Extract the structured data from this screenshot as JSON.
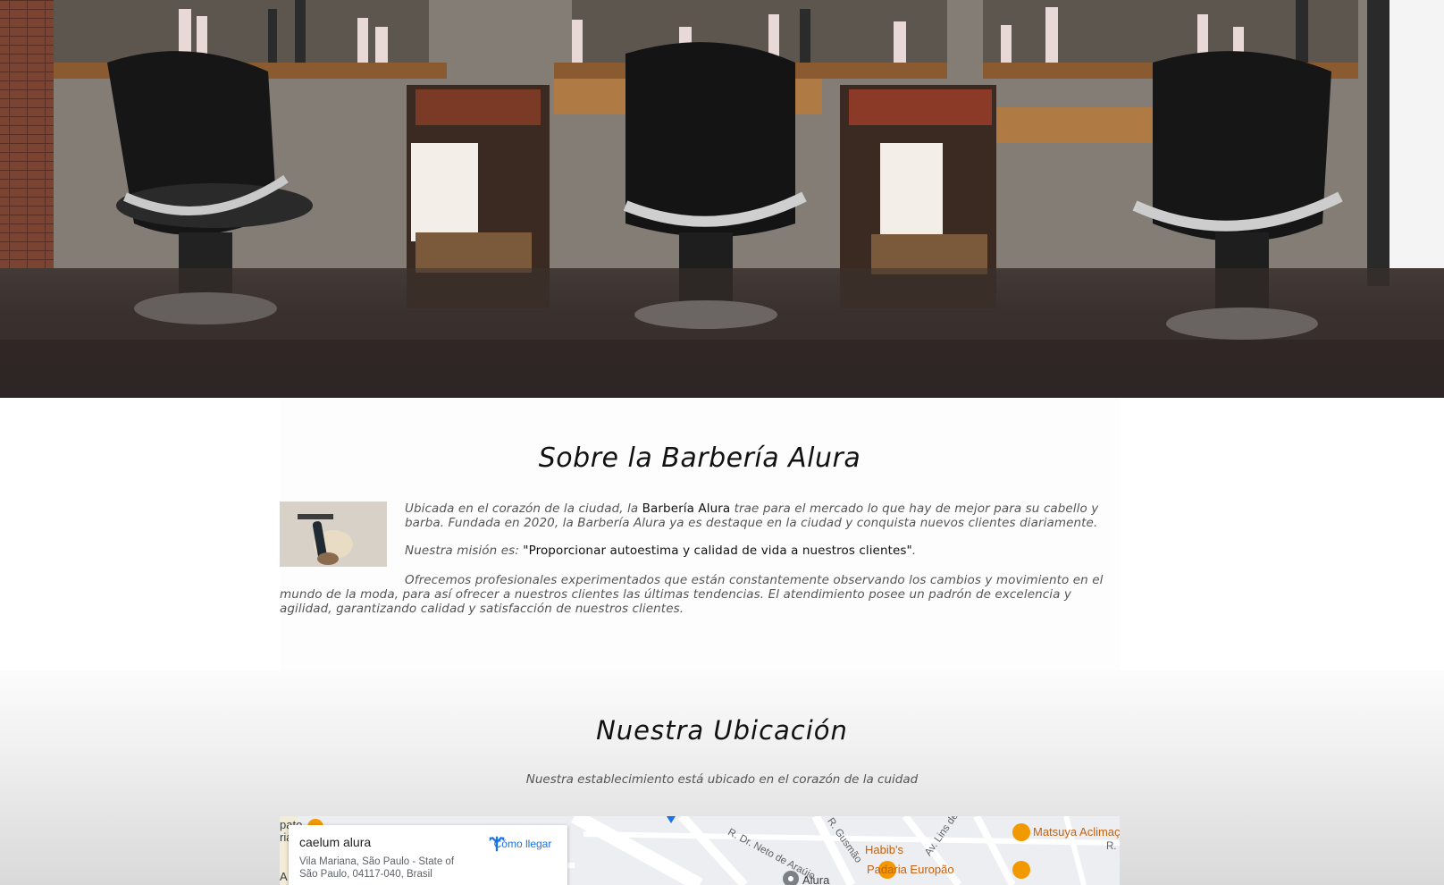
{
  "hero": {
    "image_alt": "barbershop-interior-photo"
  },
  "about": {
    "title": "Sobre la Barbería Alura",
    "thumbnail_icon": "razor-and-brush-photo",
    "paragraph1_pre": "Ubicada en el corazón de la ciudad, la ",
    "paragraph1_bold": "Barbería Alura",
    "paragraph1_post": " trae para el mercado lo que hay de mejor para su cabello y barba. Fundada en 2020, la Barbería Alura ya es destaque en la ciudad y conquista nuevos clientes diariamente.",
    "paragraph2_pre": "Nuestra misión es: ",
    "paragraph2_quote": "\"Proporcionar autoestima y calidad de vida a nuestros clientes\"",
    "paragraph2_post": ".",
    "paragraph3": "Ofrecemos profesionales experimentados que están constantemente observando los cambios y movimiento en el mundo de la moda, para así ofrecer a nuestros clientes las últimas tendencias. El atendimiento posee un padrón de excelencia y agilidad, garantizando calidad y satisfacción de nuestros clientes."
  },
  "location": {
    "title": "Nuestra Ubicación",
    "subtitle": "Nuestra establecimiento está ubicado en el corazón de la cuidad",
    "map": {
      "place_name": "caelum alura",
      "address": "Vila Mariana, São Paulo - State of São Paulo, 04117-040, Brasil",
      "directions_label": "Cómo llegar",
      "directions_icon": "directions-icon",
      "labels": {
        "road1": "R. Dr. Neto de Araújo",
        "road2": "R. Gusmão",
        "road3": "Av. Lins de",
        "road4": "R.",
        "poi1": "Habib's",
        "poi2": "Padaria Europão",
        "poi3": "Matsuya Aclimação",
        "poi4": "Alura",
        "edge1": "pato",
        "edge2": "ria",
        "edge3": "A"
      },
      "colors": {
        "poi": "#f29900",
        "link": "#1a73e8",
        "pin": "#1a73e8"
      }
    }
  }
}
